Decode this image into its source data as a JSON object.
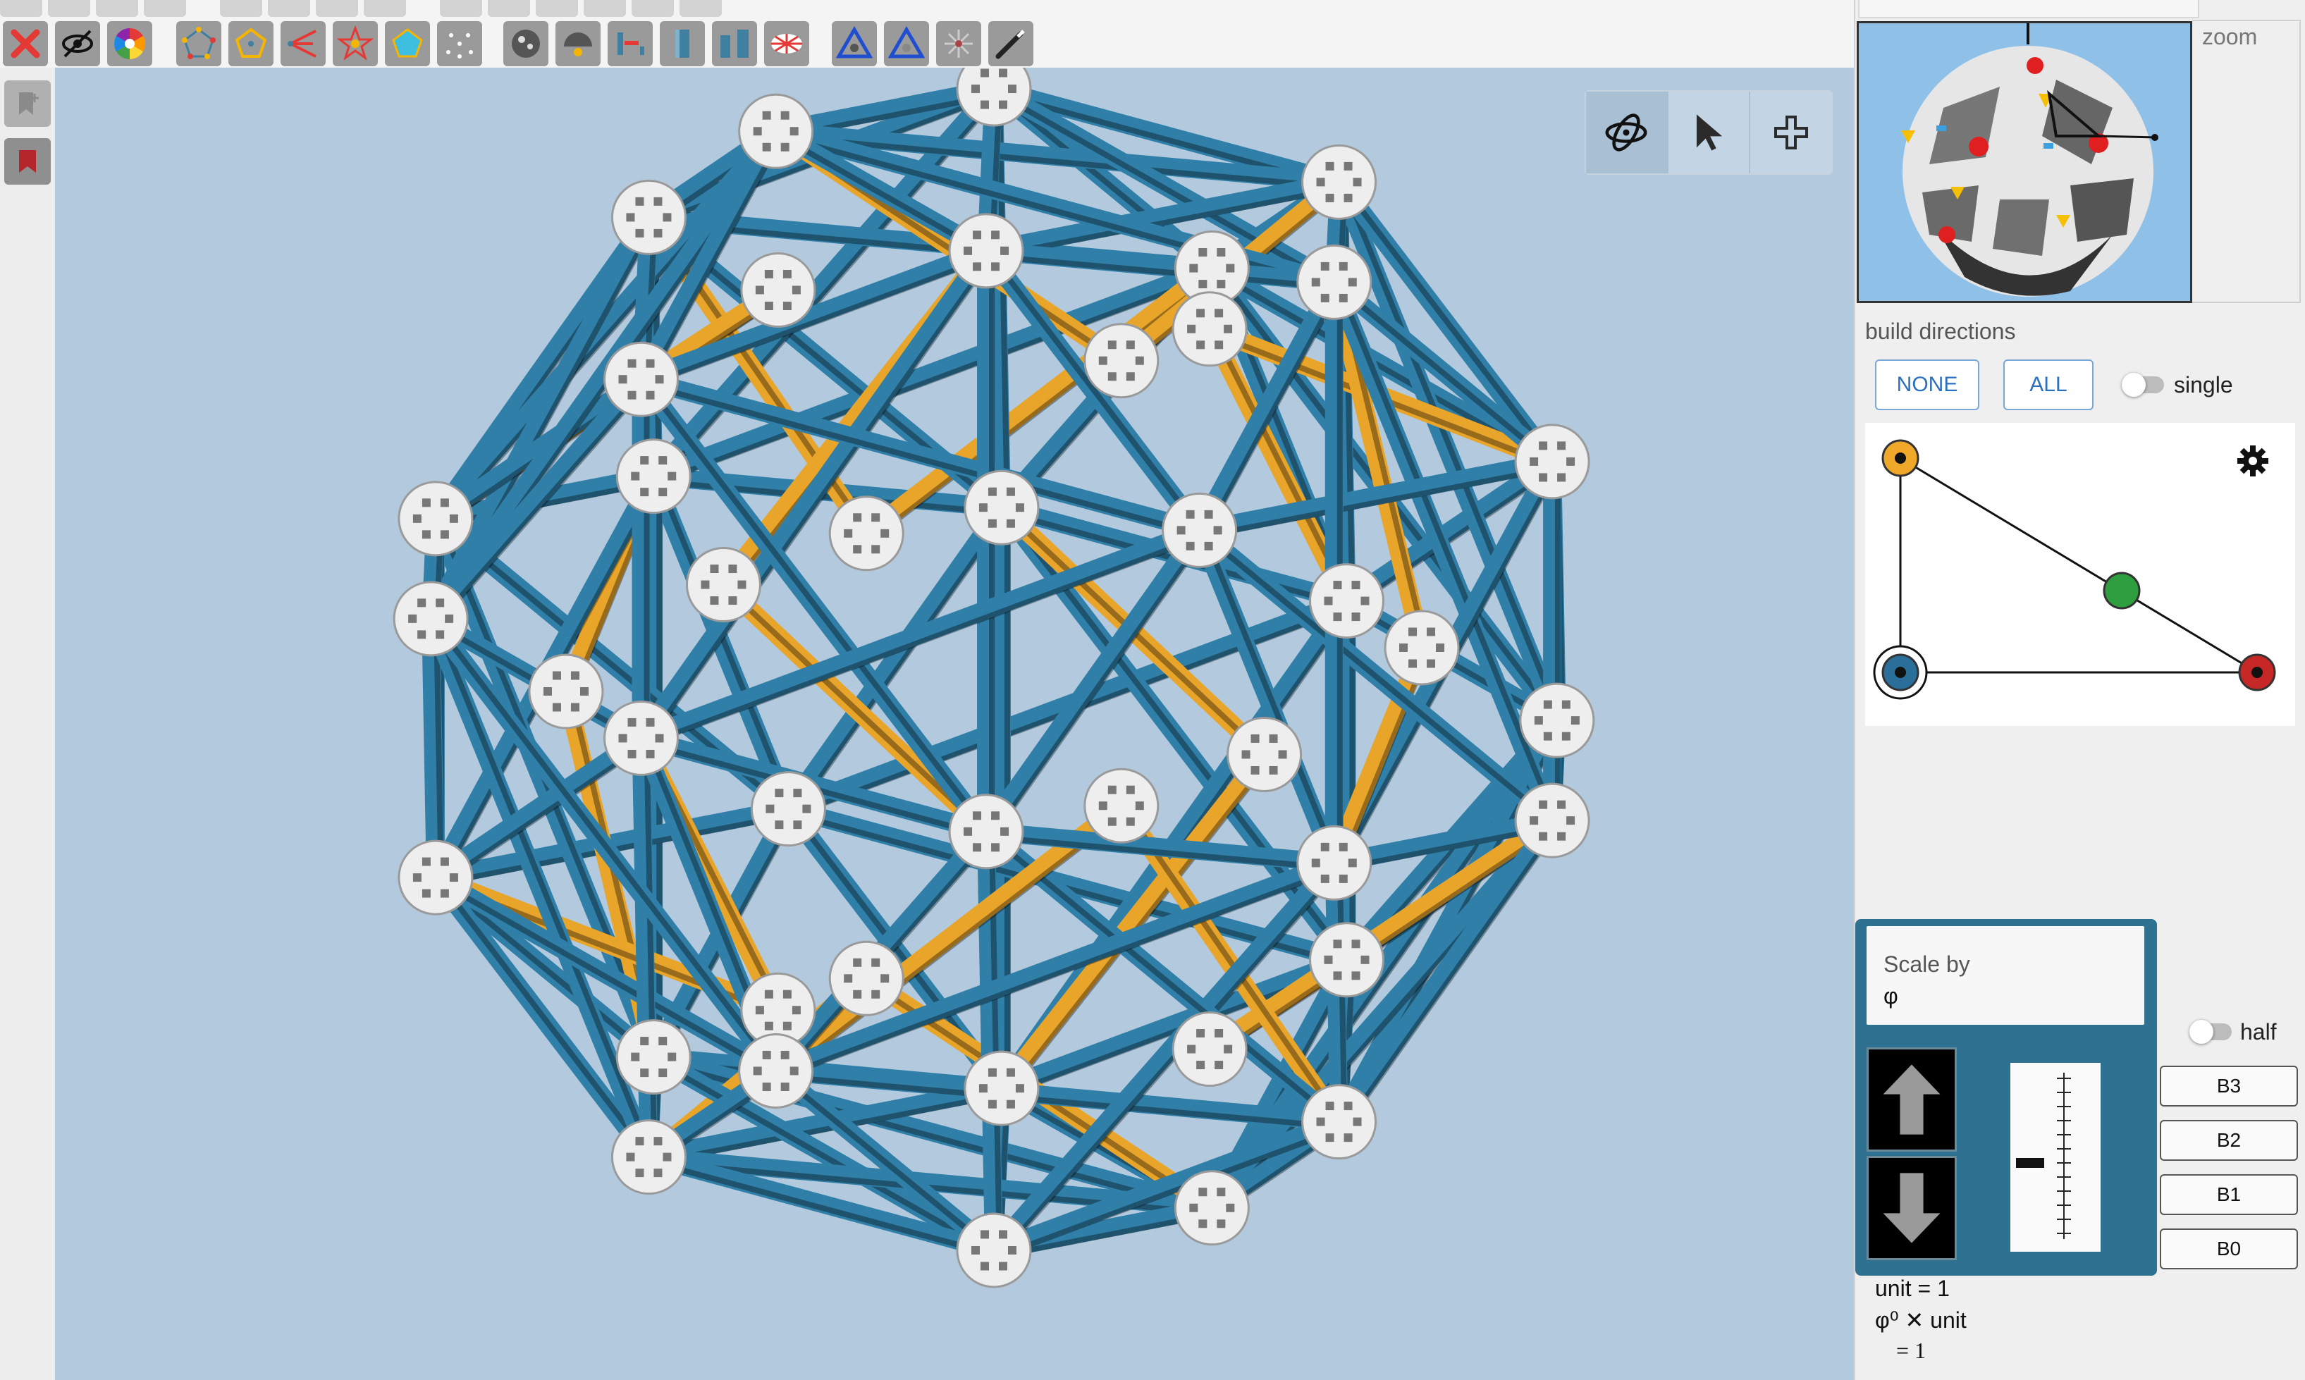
{
  "toolbar": {
    "tools": [
      {
        "name": "delete-icon",
        "color": "#e53935"
      },
      {
        "name": "hide-icon",
        "color": "#222222"
      },
      {
        "name": "color-wheel-icon",
        "color": "#ff9800"
      },
      {
        "name": "pentagon-center-icon",
        "color": "#f5b400"
      },
      {
        "name": "pentagon-edges-icon",
        "color": "#f5b400"
      },
      {
        "name": "chevron-edges-icon",
        "color": "#e53935"
      },
      {
        "name": "star-edges-icon",
        "color": "#e53935"
      },
      {
        "name": "polygon-fill-icon",
        "color": "#3fbfe0"
      },
      {
        "name": "point-cloud-icon",
        "color": "#3f7fa0"
      },
      {
        "name": "sphere-icon",
        "color": "#555555"
      },
      {
        "name": "hemisphere-icon",
        "color": "#555555"
      },
      {
        "name": "strut-measure-icon",
        "color": "#3f7fa0"
      },
      {
        "name": "pillar-icon",
        "color": "#3f7fa0"
      },
      {
        "name": "pillar-pair-icon",
        "color": "#3f7fa0"
      },
      {
        "name": "radial-icon",
        "color": "#e53935"
      },
      {
        "name": "triangle-blue-icon",
        "color": "#1f4fd0"
      },
      {
        "name": "triangle-blue-2-icon",
        "color": "#1f4fd0"
      },
      {
        "name": "starburst-icon",
        "color": "#aa4444"
      },
      {
        "name": "wand-icon",
        "color": "#333333"
      }
    ]
  },
  "viewport": {
    "background": "#b3c9dd",
    "modes": [
      {
        "name": "orbit-mode-button",
        "icon": "orbit-icon",
        "active": true
      },
      {
        "name": "select-mode-button",
        "icon": "cursor-icon",
        "active": false
      },
      {
        "name": "add-mode-button",
        "icon": "plus-icon",
        "active": false
      }
    ]
  },
  "panel": {
    "zoom_label": "zoom",
    "build_directions_label": "build directions",
    "none_label": "NONE",
    "all_label": "ALL",
    "single_label": "single",
    "single_on": false,
    "half_label": "half",
    "half_on": false,
    "orbit_dots": {
      "yellow": "#f0a82a",
      "green": "#2e9e3f",
      "red": "#c62828",
      "blue": "#2a6f99"
    }
  },
  "scale": {
    "label": "Scale by",
    "symbol": "φ",
    "buttons": [
      "B3",
      "B2",
      "B1",
      "B0"
    ],
    "unit_line": "unit = 1",
    "expr_line": "φ⁰ ✕ unit",
    "result_line": "= 1"
  },
  "colors": {
    "blue_strut": "#2f7fa8",
    "red_strut": "#c9221b",
    "yellow_strut": "#e9a52a",
    "ball": "#eeeeee"
  }
}
